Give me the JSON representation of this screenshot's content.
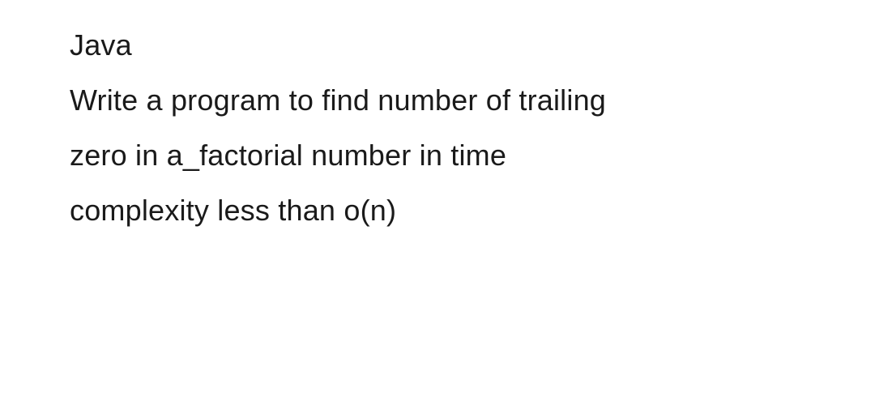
{
  "problem": {
    "language": "Java",
    "line1": "Write a program to find number of trailing",
    "line2": "zero in  a_factorial  number in time",
    "line3": "complexity less than o(n)"
  }
}
